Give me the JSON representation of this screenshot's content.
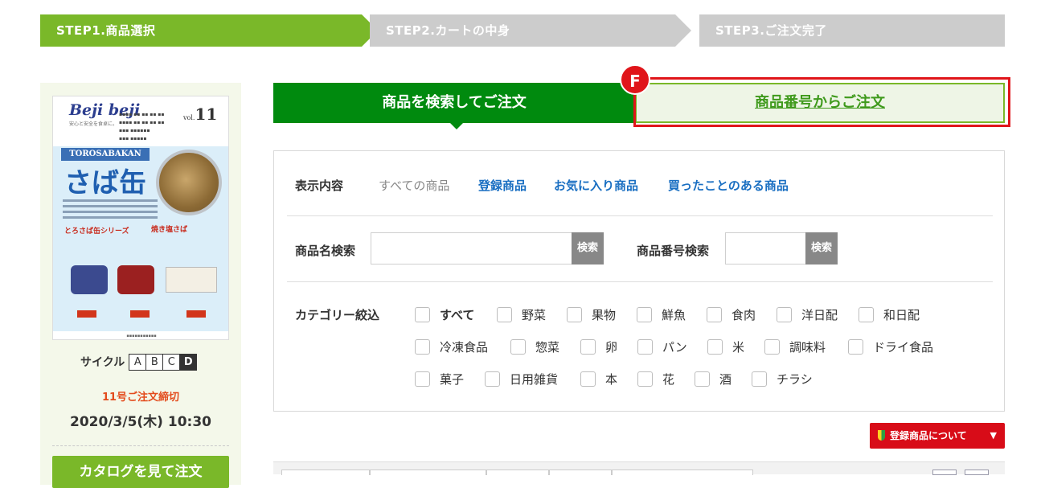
{
  "steps": [
    {
      "label": "STEP1.商品選択"
    },
    {
      "label": "STEP2.カートの中身"
    },
    {
      "label": "STEP3.ご注文完了"
    }
  ],
  "catalog": {
    "logo": "Beji beji",
    "logo_tagline": "安心と安全を食卓に。",
    "vol_prefix": "vol.",
    "vol_number": "11",
    "banner": "TOROSABAKAN",
    "title": "さば缶",
    "series_label": "とろさば缶シリーズ",
    "series_label2": "焼き塩さば"
  },
  "cycle": {
    "label": "サイクル",
    "options": [
      "A",
      "B",
      "C",
      "D"
    ],
    "selected": "D"
  },
  "deadline": {
    "note": "11号ご注文締切",
    "date": "2020/3/5(木) 10:30"
  },
  "catalog_button": "カタログを見て注文",
  "tabs": {
    "search": "商品を検索してご注文",
    "number": "商品番号からご注文"
  },
  "badge": "F",
  "display": {
    "label": "表示内容",
    "links": [
      "すべての商品",
      "登録商品",
      "お気に入り商品",
      "買ったことのある商品"
    ]
  },
  "name_search": {
    "label": "商品名検索",
    "button": "検索",
    "value": ""
  },
  "number_search": {
    "label": "商品番号検索",
    "button": "検索",
    "value": ""
  },
  "category": {
    "label": "カテゴリー絞込",
    "row1": [
      "すべて",
      "野菜",
      "果物",
      "鮮魚",
      "食肉",
      "洋日配",
      "和日配"
    ],
    "row2": [
      "冷凍食品",
      "惣菜",
      "卵",
      "パン",
      "米",
      "調味料",
      "ドライ食品"
    ],
    "row3": [
      "菓子",
      "日用雑貨",
      "本",
      "花",
      "酒",
      "チラシ"
    ]
  },
  "registered_button": "登録商品について",
  "colors": {
    "step_active": "#7ab829",
    "step_inactive": "#cccccc",
    "tab_active": "#008a0e",
    "highlight": "#e0151a",
    "link": "#1a6fc2",
    "deadline": "#e34b1c"
  }
}
